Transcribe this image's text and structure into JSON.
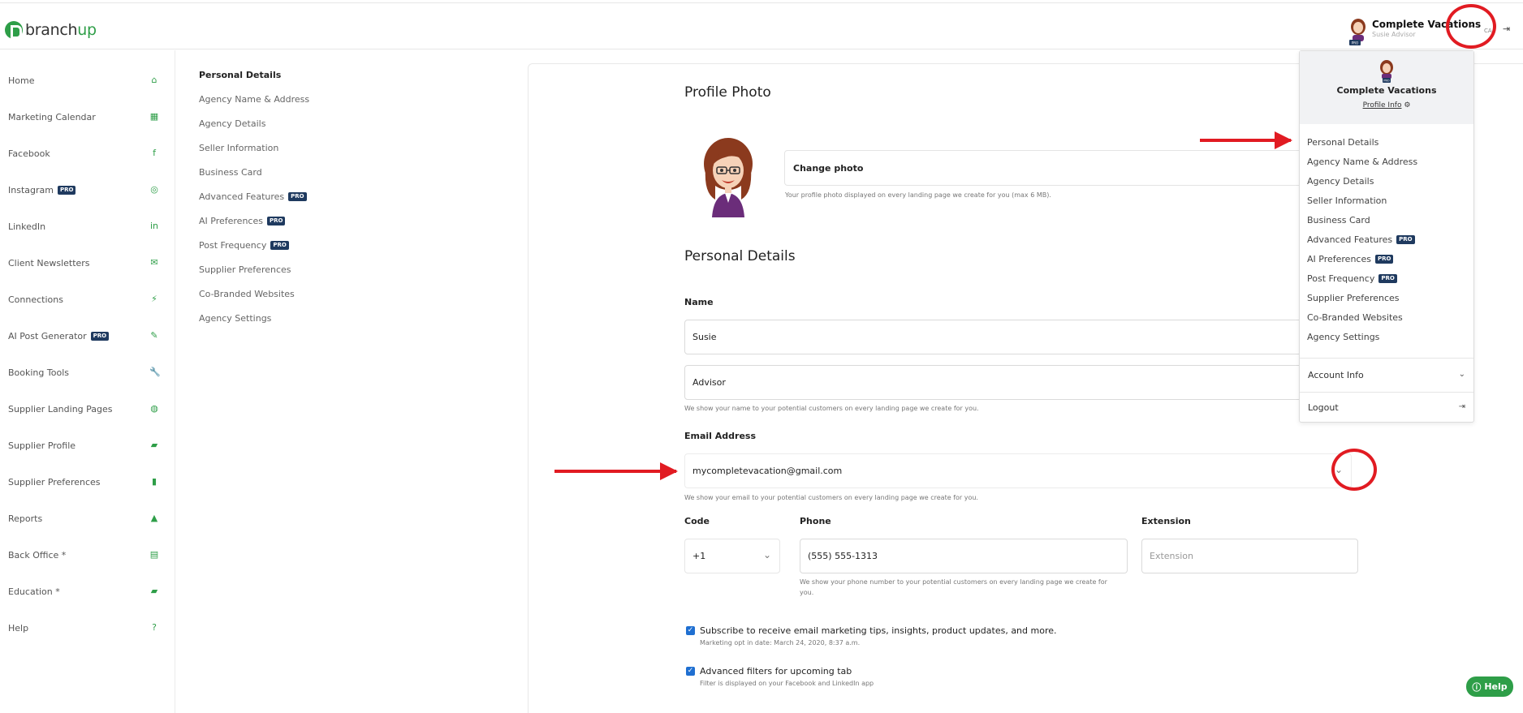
{
  "brand": {
    "logo_main": "branch",
    "logo_accent": "up",
    "accent_color": "#2e9e48"
  },
  "header": {
    "user_name": "Complete Vacations",
    "user_role": "Susie Advisor",
    "caret_icon": "chevron-up-icon",
    "extra_text": "CA",
    "logout_icon": "logout-icon"
  },
  "sidebar": {
    "items": [
      {
        "label": "Home",
        "icon": "home-icon",
        "glyph": "⌂",
        "pro": false
      },
      {
        "label": "Marketing Calendar",
        "icon": "calendar-icon",
        "glyph": "▦",
        "pro": false
      },
      {
        "label": "Facebook",
        "icon": "facebook-icon",
        "glyph": "f",
        "pro": false
      },
      {
        "label": "Instagram",
        "icon": "instagram-icon",
        "glyph": "◎",
        "pro": true
      },
      {
        "label": "LinkedIn",
        "icon": "linkedin-icon",
        "glyph": "in",
        "pro": false
      },
      {
        "label": "Client Newsletters",
        "icon": "envelope-icon",
        "glyph": "✉",
        "pro": false
      },
      {
        "label": "Connections",
        "icon": "plug-icon",
        "glyph": "⚡",
        "pro": false
      },
      {
        "label": "AI Post Generator",
        "icon": "edit-icon",
        "glyph": "✎",
        "pro": true
      },
      {
        "label": "Booking Tools",
        "icon": "wrench-icon",
        "glyph": "🔧",
        "pro": false
      },
      {
        "label": "Supplier Landing Pages",
        "icon": "globe-icon",
        "glyph": "◍",
        "pro": false
      },
      {
        "label": "Supplier Profile",
        "icon": "book-icon",
        "glyph": "▰",
        "pro": false
      },
      {
        "label": "Supplier Preferences",
        "icon": "bookmark-icon",
        "glyph": "▮",
        "pro": false
      },
      {
        "label": "Reports",
        "icon": "chart-icon",
        "glyph": "▲",
        "pro": false
      },
      {
        "label": "Back Office *",
        "icon": "map-icon",
        "glyph": "▤",
        "pro": false
      },
      {
        "label": "Education *",
        "icon": "book-icon",
        "glyph": "▰",
        "pro": false
      },
      {
        "label": "Help",
        "icon": "question-icon",
        "glyph": "?",
        "pro": false
      }
    ],
    "pro_label": "PRO"
  },
  "subnav": {
    "items": [
      {
        "label": "Personal Details",
        "active": true,
        "pro": false
      },
      {
        "label": "Agency Name & Address",
        "active": false,
        "pro": false
      },
      {
        "label": "Agency Details",
        "active": false,
        "pro": false
      },
      {
        "label": "Seller Information",
        "active": false,
        "pro": false
      },
      {
        "label": "Business Card",
        "active": false,
        "pro": false
      },
      {
        "label": "Advanced Features",
        "active": false,
        "pro": true
      },
      {
        "label": "AI Preferences",
        "active": false,
        "pro": true
      },
      {
        "label": "Post Frequency",
        "active": false,
        "pro": true
      },
      {
        "label": "Supplier Preferences",
        "active": false,
        "pro": false
      },
      {
        "label": "Co-Branded Websites",
        "active": false,
        "pro": false
      },
      {
        "label": "Agency Settings",
        "active": false,
        "pro": false
      }
    ]
  },
  "main": {
    "profile_photo_title": "Profile Photo",
    "change_photo_label": "Change photo",
    "photo_help": "Your profile photo displayed on every landing page we create for you (max 6 MB).",
    "personal_details_title": "Personal Details",
    "name_label": "Name",
    "first_name_value": "Susie",
    "last_name_value": "Advisor",
    "name_help": "We show your name to your potential customers on every landing page we create for you.",
    "email_label": "Email Address",
    "email_value": "mycompletevacation@gmail.com",
    "email_help": "We show your email to your potential customers on every landing page we create for you.",
    "code_label": "Code",
    "code_value": "+1",
    "phone_label": "Phone",
    "phone_value": "(555) 555-1313",
    "phone_help_line1": "We show your phone number to your potential customers on every landing page we create for",
    "phone_help_line2": "you.",
    "extension_label": "Extension",
    "extension_placeholder": "Extension",
    "subscribe_label": "Subscribe to receive email marketing tips, insights, product updates, and more.",
    "subscribe_sub": "Marketing opt in date: March 24, 2020, 8:37 a.m.",
    "filters_label": "Advanced filters for upcoming tab",
    "filters_sub": "Filter is displayed on your Facebook and LinkedIn app",
    "checkbox_checked": true
  },
  "dropdown": {
    "name": "Complete Vacations",
    "profile_info": "Profile Info",
    "items": [
      {
        "label": "Personal Details",
        "pro": false
      },
      {
        "label": "Agency Name & Address",
        "pro": false
      },
      {
        "label": "Agency Details",
        "pro": false
      },
      {
        "label": "Seller Information",
        "pro": false
      },
      {
        "label": "Business Card",
        "pro": false
      },
      {
        "label": "Advanced Features",
        "pro": true
      },
      {
        "label": "AI Preferences",
        "pro": true
      },
      {
        "label": "Post Frequency",
        "pro": true
      },
      {
        "label": "Supplier Preferences",
        "pro": false
      },
      {
        "label": "Co-Branded Websites",
        "pro": false
      },
      {
        "label": "Agency Settings",
        "pro": false
      }
    ],
    "account_info": "Account Info",
    "logout": "Logout"
  },
  "help_button": {
    "label": "Help"
  },
  "annotation_color": "#e11b22"
}
